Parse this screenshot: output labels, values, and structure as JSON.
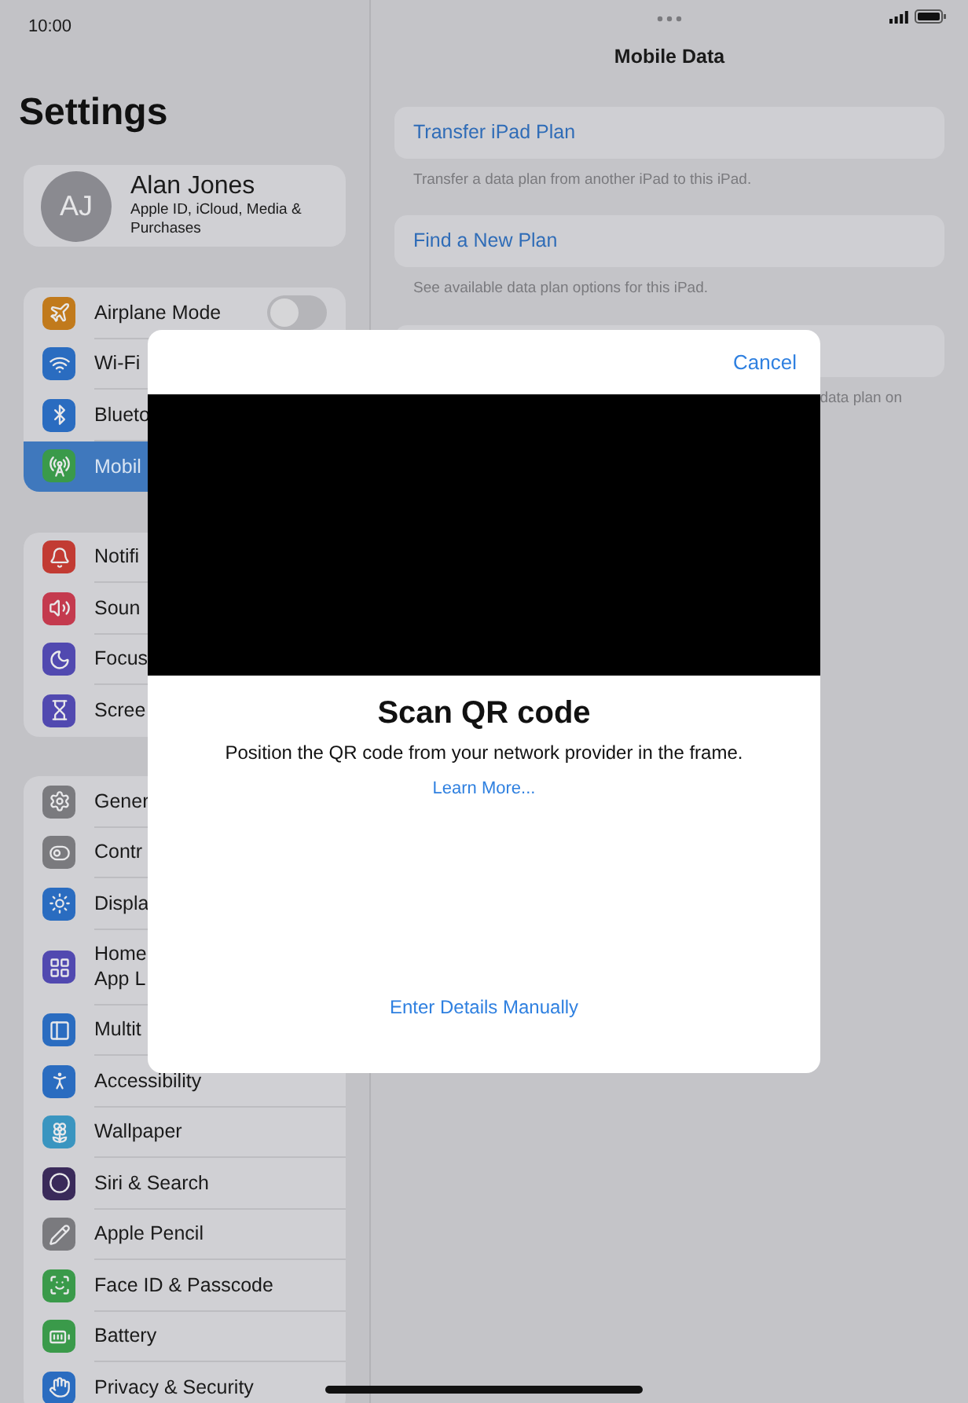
{
  "status_bar": {
    "time": "10:00"
  },
  "sidebar": {
    "title": "Settings",
    "profile": {
      "initials": "AJ",
      "name": "Alan Jones",
      "subtitle": "Apple ID, iCloud, Media & Purchases"
    },
    "groups": [
      [
        {
          "label": "Airplane Mode",
          "kind": "toggle",
          "on": false,
          "selected": false
        },
        {
          "label": "Wi-Fi",
          "kind": "link",
          "selected": false
        },
        {
          "label": "Blueto",
          "kind": "link",
          "selected": false
        },
        {
          "label": "Mobil",
          "kind": "link",
          "selected": true
        }
      ],
      [
        {
          "label": "Notifi",
          "kind": "link",
          "selected": false
        },
        {
          "label": "Soun",
          "kind": "link",
          "selected": false
        },
        {
          "label": "Focus",
          "kind": "link",
          "selected": false
        },
        {
          "label": "Scree",
          "kind": "link",
          "selected": false
        }
      ],
      [
        {
          "label": "Gener",
          "kind": "link",
          "selected": false
        },
        {
          "label": "Contr",
          "kind": "link",
          "selected": false
        },
        {
          "label": "Displa",
          "kind": "link",
          "selected": false
        },
        {
          "label": "Home\nApp L",
          "kind": "link",
          "selected": false
        },
        {
          "label": "Multit",
          "kind": "link",
          "selected": false
        },
        {
          "label": "Accessibility",
          "kind": "link",
          "selected": false
        },
        {
          "label": "Wallpaper",
          "kind": "link",
          "selected": false
        },
        {
          "label": "Siri & Search",
          "kind": "link",
          "selected": false
        },
        {
          "label": "Apple Pencil",
          "kind": "link",
          "selected": false
        },
        {
          "label": "Face ID & Passcode",
          "kind": "link",
          "selected": false
        },
        {
          "label": "Battery",
          "kind": "link",
          "selected": false
        },
        {
          "label": "Privacy & Security",
          "kind": "link",
          "selected": false
        }
      ]
    ]
  },
  "detail": {
    "title": "Mobile Data",
    "sections": [
      {
        "action": "Transfer iPad Plan",
        "footer": "Transfer a data plan from another iPad to this iPad."
      },
      {
        "action": "Find a New Plan",
        "footer": "See available data plan options for this iPad."
      },
      {
        "footer": "data plan on"
      }
    ]
  },
  "modal": {
    "cancel": "Cancel",
    "title": "Scan QR code",
    "message": "Position the QR code from your network provider in the frame.",
    "link": "Learn More...",
    "manual": "Enter Details Manually"
  }
}
